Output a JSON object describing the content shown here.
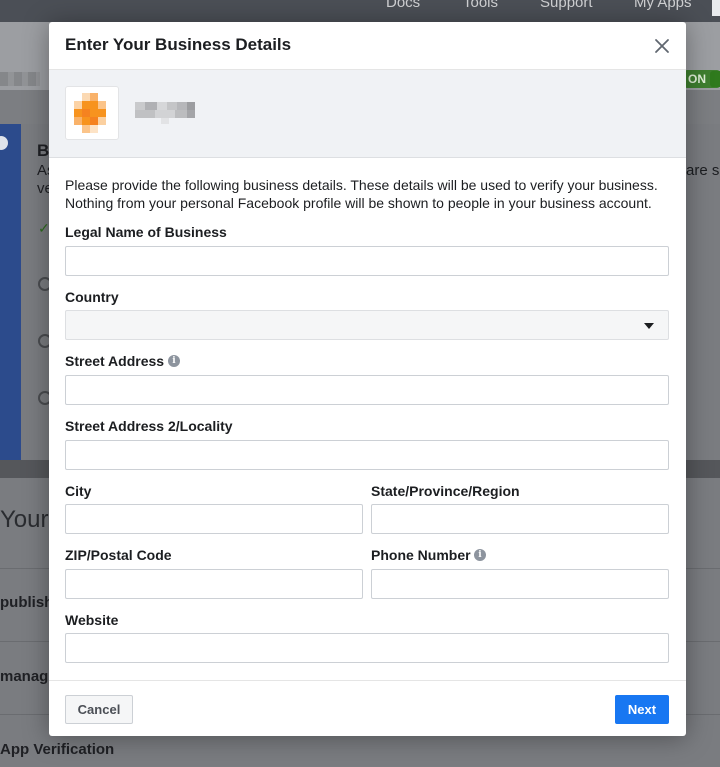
{
  "top_nav": [
    "Docs",
    "Tools",
    "Support",
    "My Apps"
  ],
  "background": {
    "toggle_label": "ON",
    "card_heading": "B",
    "card_line1": "As",
    "card_line2": "ve",
    "right_text": "are s",
    "section_title": "Your",
    "rows": [
      "publish",
      "manag",
      "App Verification"
    ]
  },
  "modal": {
    "title": "Enter Your Business Details",
    "intro": "Please provide the following business details. These details will be used to verify your business. Nothing from your personal Facebook profile will be shown to people in your business account.",
    "fields": {
      "legal_name": {
        "label": "Legal Name of Business",
        "value": ""
      },
      "country": {
        "label": "Country",
        "value": ""
      },
      "street": {
        "label": "Street Address",
        "value": ""
      },
      "street2": {
        "label": "Street Address 2/Locality",
        "value": ""
      },
      "city": {
        "label": "City",
        "value": ""
      },
      "state": {
        "label": "State/Province/Region",
        "value": ""
      },
      "zip": {
        "label": "ZIP/Postal Code",
        "value": ""
      },
      "phone": {
        "label": "Phone Number",
        "value": ""
      },
      "website": {
        "label": "Website",
        "value": ""
      }
    },
    "buttons": {
      "cancel": "Cancel",
      "next": "Next"
    }
  },
  "colors": {
    "accent": "#1877f2",
    "app_icon": "#f7931e",
    "toggle": "#3e7f2f"
  },
  "icons": {
    "close": "close-icon",
    "info": "info-icon",
    "dropdown": "chevron-down-icon"
  }
}
